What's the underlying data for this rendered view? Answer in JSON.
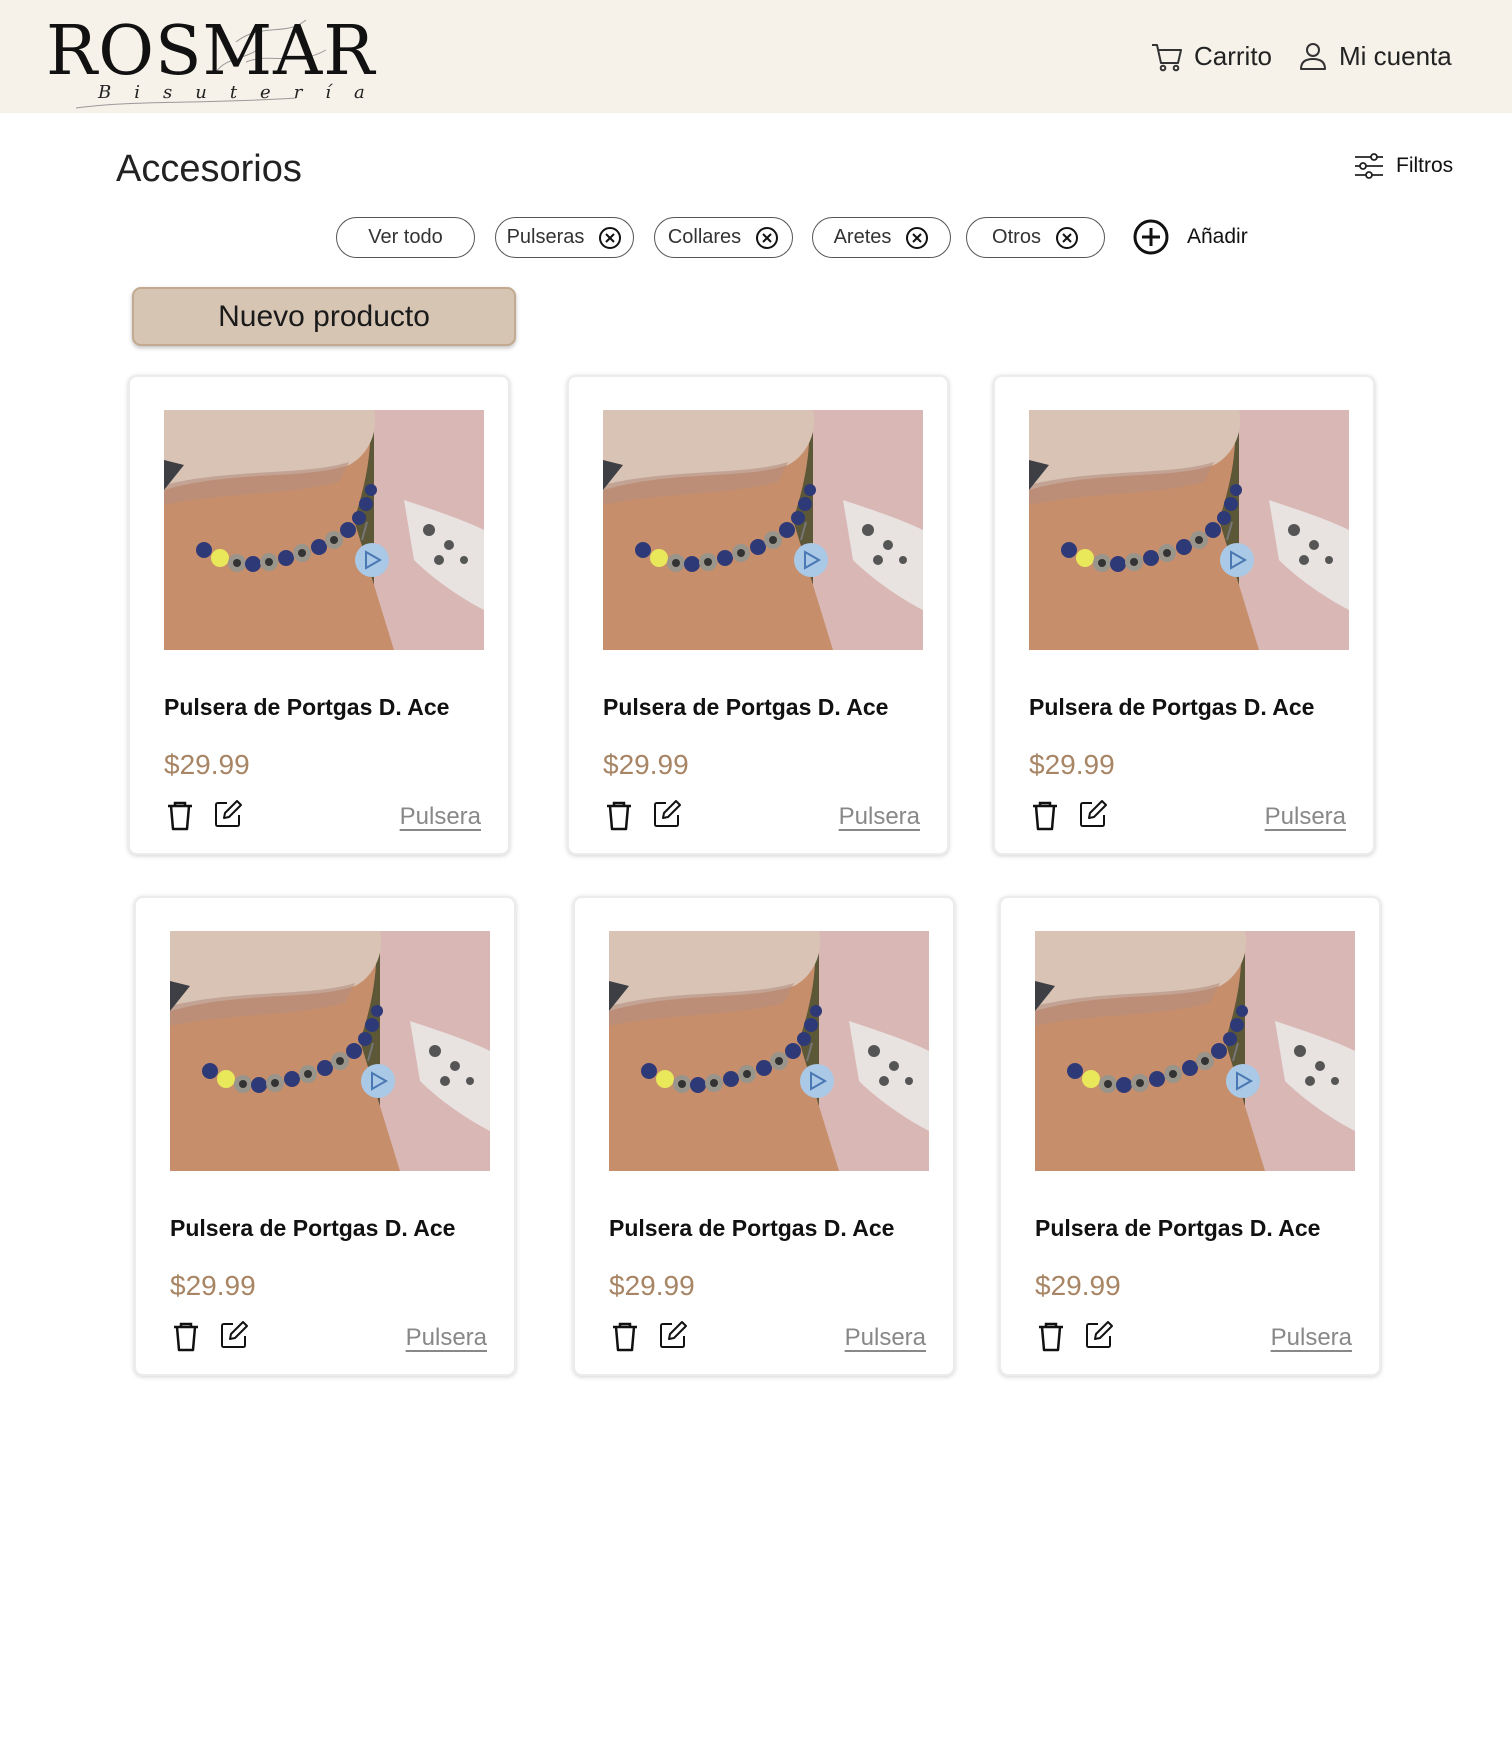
{
  "header": {
    "logo_main": "ROSMAR",
    "logo_sub": "Bisutería",
    "cart_label": "Carrito",
    "account_label": "Mi cuenta"
  },
  "page": {
    "title": "Accesorios",
    "filters_label": "Filtros"
  },
  "chips": [
    {
      "label": "Ver todo",
      "removable": false
    },
    {
      "label": "Pulseras",
      "removable": true
    },
    {
      "label": "Collares",
      "removable": true
    },
    {
      "label": "Aretes",
      "removable": true
    },
    {
      "label": "Otros",
      "removable": true
    }
  ],
  "add_label": "Añadir",
  "new_product_label": "Nuevo producto",
  "products": [
    {
      "name": "Pulsera de Portgas D. Ace",
      "price": "$29.99",
      "category": "Pulsera"
    },
    {
      "name": "Pulsera de Portgas D. Ace",
      "price": "$29.99",
      "category": "Pulsera"
    },
    {
      "name": "Pulsera de Portgas D. Ace",
      "price": "$29.99",
      "category": "Pulsera"
    },
    {
      "name": "Pulsera de Portgas D. Ace",
      "price": "$29.99",
      "category": "Pulsera"
    },
    {
      "name": "Pulsera de Portgas D. Ace",
      "price": "$29.99",
      "category": "Pulsera"
    },
    {
      "name": "Pulsera de Portgas D. Ace",
      "price": "$29.99",
      "category": "Pulsera"
    }
  ],
  "colors": {
    "header_bg": "#f6f1e9",
    "price": "#a88565",
    "button_bg": "#d7c5b3"
  }
}
